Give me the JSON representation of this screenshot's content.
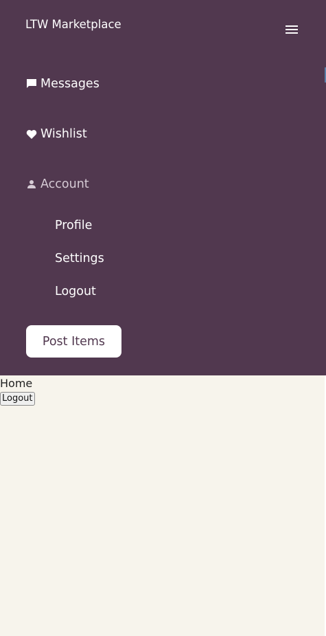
{
  "brand": {
    "title": "LTW Marketplace"
  },
  "colors": {
    "header_bg": "#51384f",
    "main_bg": "#f7f4ec",
    "text_light": "#ffffff"
  },
  "nav": {
    "messages": {
      "label": "Messages",
      "icon": "chat-bubble-icon"
    },
    "wishlist": {
      "label": "Wishlist",
      "icon": "heart-icon"
    },
    "account": {
      "label": "Account",
      "icon": "person-icon",
      "submenu": [
        {
          "label": "Profile"
        },
        {
          "label": "Settings"
        },
        {
          "label": "Logout"
        }
      ]
    },
    "post_button": "Post Items"
  },
  "main": {
    "home_link": "Home",
    "logout_button": "Logout"
  }
}
